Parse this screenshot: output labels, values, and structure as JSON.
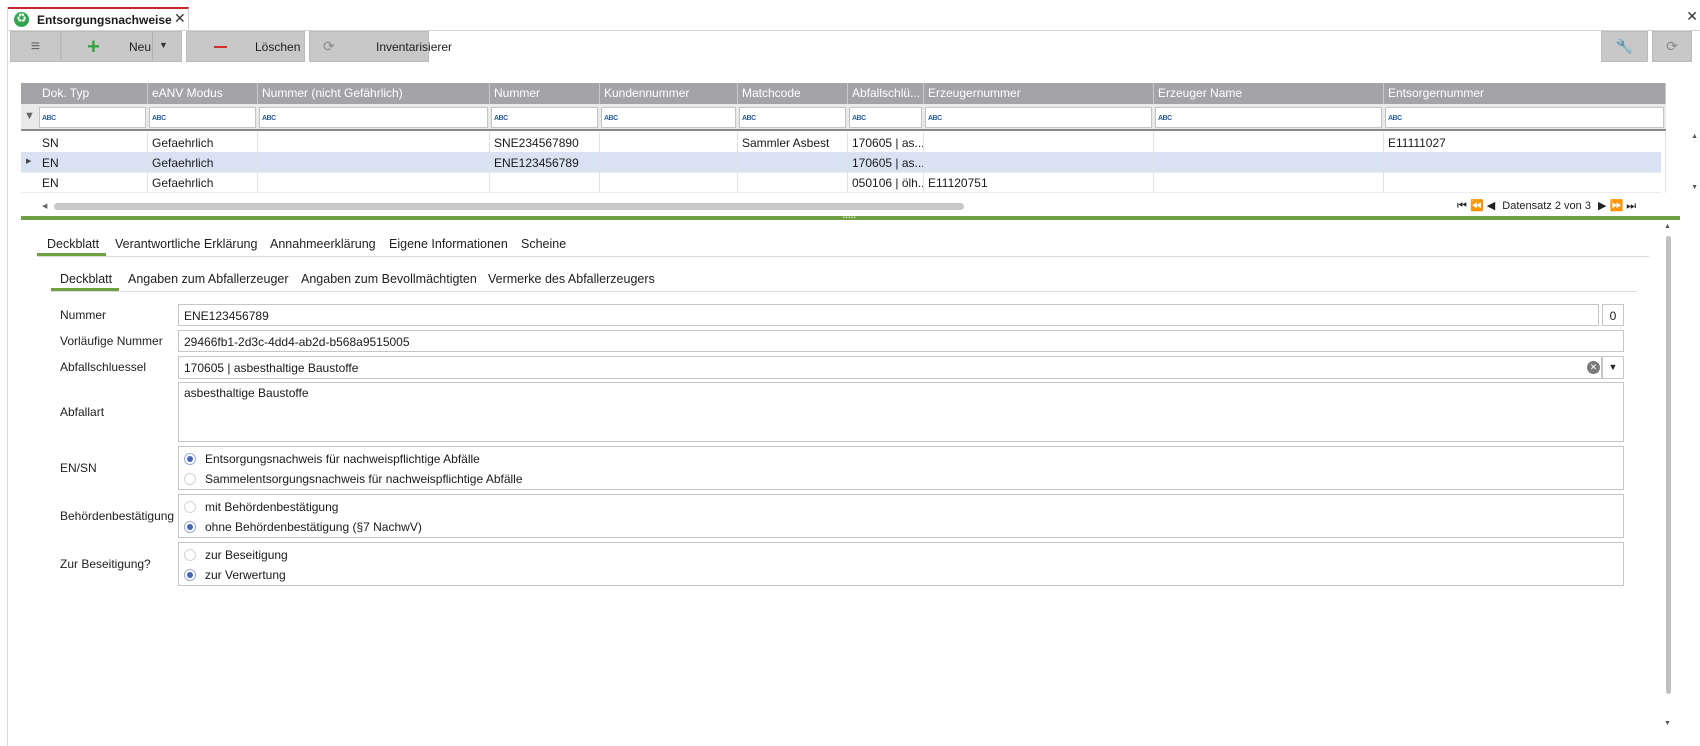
{
  "window": {
    "tab_title": "Entsorgungsnachweise",
    "tab_icon": "recycle-icon",
    "close_glyph": "✕"
  },
  "toolbar": {
    "menu_icon": "≡",
    "new_label": "Neu",
    "delete_label": "Löschen",
    "inventory_label": "Inventarisierer"
  },
  "grid": {
    "columns": [
      "Dok. Typ",
      "eANV Modus",
      "Nummer (nicht Gefährlich)",
      "Nummer",
      "Kundennummer",
      "Matchcode",
      "Abfallschlü...",
      "Erzeugernummer",
      "Erzeuger Name",
      "Entsorgernummer"
    ],
    "rows": [
      [
        "SN",
        "Gefaehrlich",
        "",
        "SNE234567890",
        "",
        "Sammler Asbest",
        "170605 | as...",
        "",
        "",
        "E11111027"
      ],
      [
        "EN",
        "Gefaehrlich",
        "",
        "ENE123456789",
        "",
        "",
        "170605 | as...",
        "",
        "",
        ""
      ],
      [
        "EN",
        "Gefaehrlich",
        "",
        "",
        "",
        "",
        "050106 | ölh...",
        "E11120751",
        "",
        ""
      ]
    ],
    "selected_row": 1,
    "record_status": "Datensatz 2 von 3"
  },
  "tabs_main": [
    "Deckblatt",
    "Verantwortliche Erklärung",
    "Annahmeerklärung",
    "Eigene Informationen",
    "Scheine"
  ],
  "tabs_sub": [
    "Deckblatt",
    "Angaben zum Abfallerzeuger",
    "Angaben zum Bevollmächtigten",
    "Vermerke des Abfallerzeugers"
  ],
  "form": {
    "nummer_label": "Nummer",
    "nummer_value": "ENE123456789",
    "nummer_counter": "0",
    "vorlaeufige_label": "Vorläufige Nummer",
    "vorlaeufige_value": "29466fb1-2d3c-4dd4-ab2d-b568a9515005",
    "abfallschluessel_label": "Abfallschluessel",
    "abfallschluessel_value": "170605 | asbesthaltige Baustoffe",
    "abfallart_label": "Abfallart",
    "abfallart_value": "asbesthaltige Baustoffe",
    "ensn_label": "EN/SN",
    "ensn_options": [
      "Entsorgungsnachweis für nachweispflichtige Abfälle",
      "Sammelentsorgungsnachweis für nachweispflichtige Abfälle"
    ],
    "ensn_selected": 0,
    "behoerde_label": "Behördenbestätigung",
    "behoerde_options": [
      "mit Behördenbestätigung",
      "ohne Behördenbestätigung (§7 NachwV)"
    ],
    "behoerde_selected": 1,
    "beseitigung_label": "Zur Beseitigung?",
    "beseitigung_options": [
      "zur Beseitigung",
      "zur Verwertung"
    ],
    "beseitigung_selected": 1
  },
  "colors": {
    "accent_green": "#6fa042",
    "header_gray": "#a4a4a8",
    "selected_row": "#d8e2f3",
    "tab_red": "#c8282d"
  }
}
